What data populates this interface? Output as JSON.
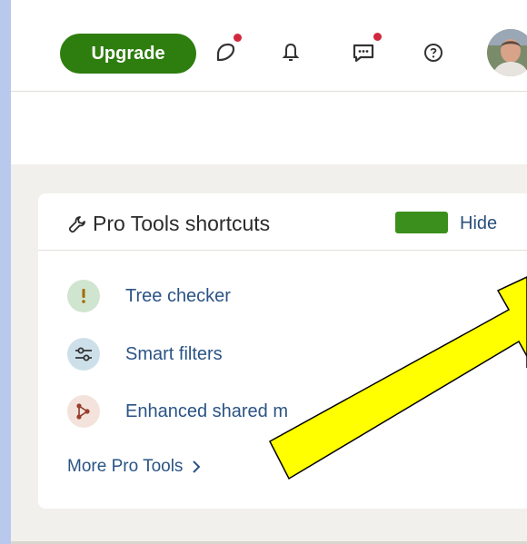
{
  "topbar": {
    "upgrade_label": "Upgrade",
    "icons": [
      "tree-activity-icon",
      "bell-icon",
      "messages-icon",
      "help-icon"
    ],
    "notification_color": "#d1283d"
  },
  "pro_tools": {
    "title": "Pro Tools shortcuts",
    "hide_label": "Hide",
    "items": [
      {
        "label": "Tree checker",
        "icon": "exclamation-icon",
        "icon_bg": "#cfe5cf"
      },
      {
        "label": "Smart filters",
        "icon": "sliders-icon",
        "icon_bg": "#cde0ea"
      },
      {
        "label": "Enhanced shared m",
        "icon": "network-icon",
        "icon_bg": "#f3e3dc"
      }
    ],
    "more_label": "More Pro Tools"
  },
  "colors": {
    "brand_green": "#2e7d0f",
    "link_blue": "#2a5485",
    "annotation_arrow": "#ffff00"
  }
}
